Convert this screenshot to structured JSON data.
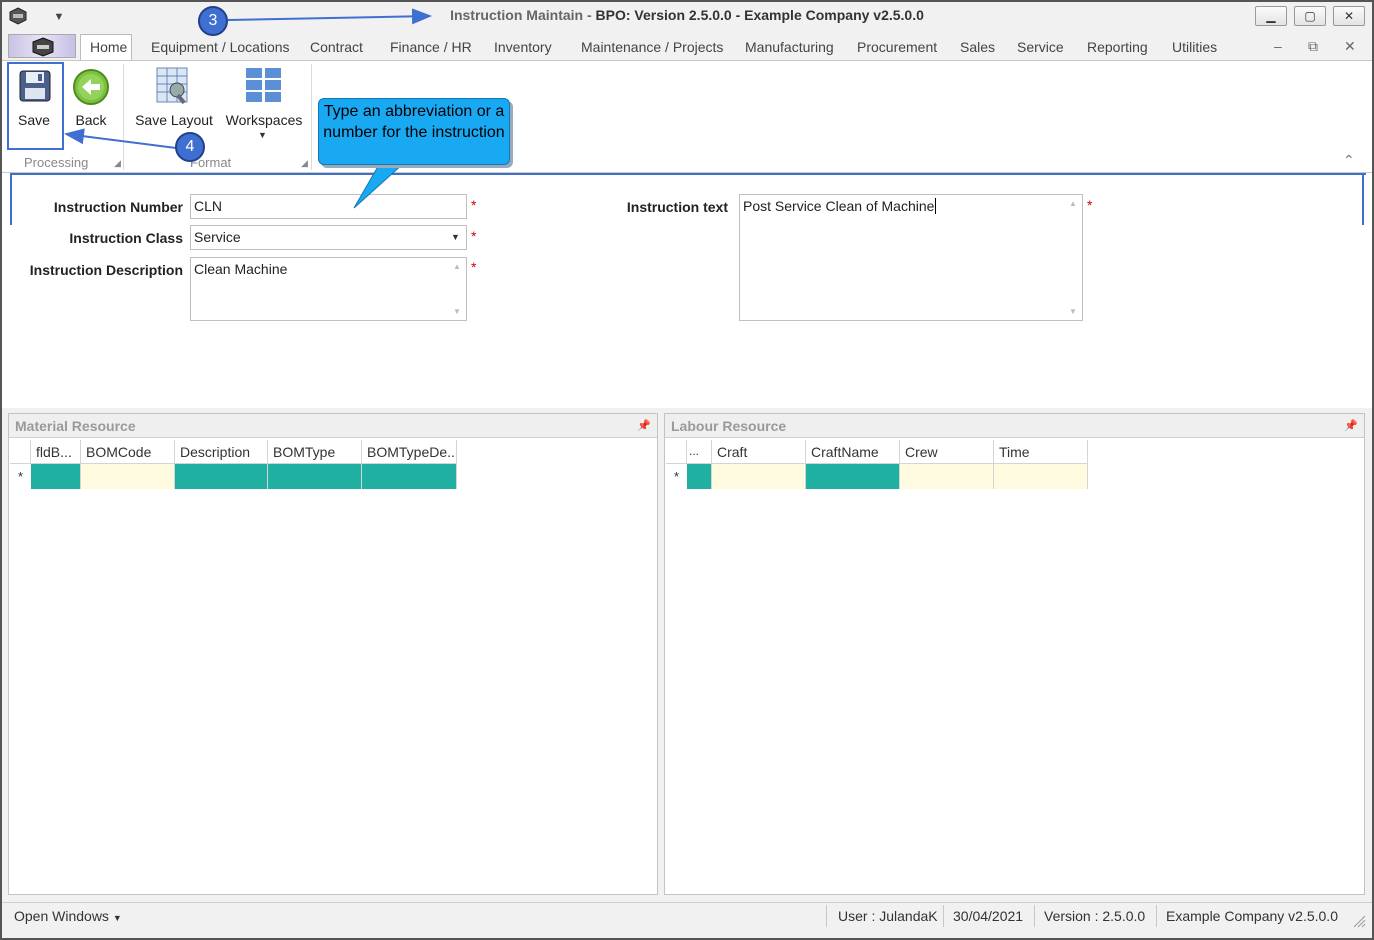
{
  "window": {
    "title_prefix": "Instruction Maintain - ",
    "title_main": "BPO: Version 2.5.0.0 - Example Company v2.5.0.0"
  },
  "tabs": [
    {
      "label": "Home",
      "active": true
    },
    {
      "label": "Equipment / Locations"
    },
    {
      "label": "Contract"
    },
    {
      "label": "Finance / HR"
    },
    {
      "label": "Inventory"
    },
    {
      "label": "Maintenance / Projects"
    },
    {
      "label": "Manufacturing"
    },
    {
      "label": "Procurement"
    },
    {
      "label": "Sales"
    },
    {
      "label": "Service"
    },
    {
      "label": "Reporting"
    },
    {
      "label": "Utilities"
    }
  ],
  "ribbon": {
    "save": "Save",
    "back": "Back",
    "save_layout": "Save Layout",
    "workspaces": "Workspaces",
    "group_processing": "Processing",
    "group_format": "Format"
  },
  "form": {
    "instruction_number_label": "Instruction Number",
    "instruction_number_value": "CLN",
    "instruction_class_label": "Instruction Class",
    "instruction_class_value": "Service",
    "instruction_description_label": "Instruction Description",
    "instruction_description_value": "Clean Machine",
    "instruction_text_label": "Instruction text",
    "instruction_text_value": "Post Service Clean of Machine",
    "required_mark": "*"
  },
  "material_resource": {
    "title": "Material Resource",
    "columns": [
      "fldB...",
      "BOMCode",
      "Description",
      "BOMType",
      "BOMTypeDe..."
    ],
    "new_row_marker": "*"
  },
  "labour_resource": {
    "title": "Labour Resource",
    "columns": [
      "...",
      "Craft",
      "CraftName",
      "Crew",
      "Time"
    ],
    "new_row_marker": "*"
  },
  "status": {
    "open_windows": "Open Windows",
    "user": "User : JulandaK",
    "date": "30/04/2021",
    "version": "Version : 2.5.0.0",
    "company": "Example Company v2.5.0.0"
  },
  "annotations": {
    "step3": "3",
    "step4": "4",
    "callout": "Type an abbreviation or a number for the instruction",
    "accent_color": "#3f6fd0",
    "callout_color": "#19a9f2"
  },
  "colors": {
    "grid_required": "#1fb0a1",
    "grid_optional": "#fffbe0",
    "required_mark": "#d40000"
  }
}
